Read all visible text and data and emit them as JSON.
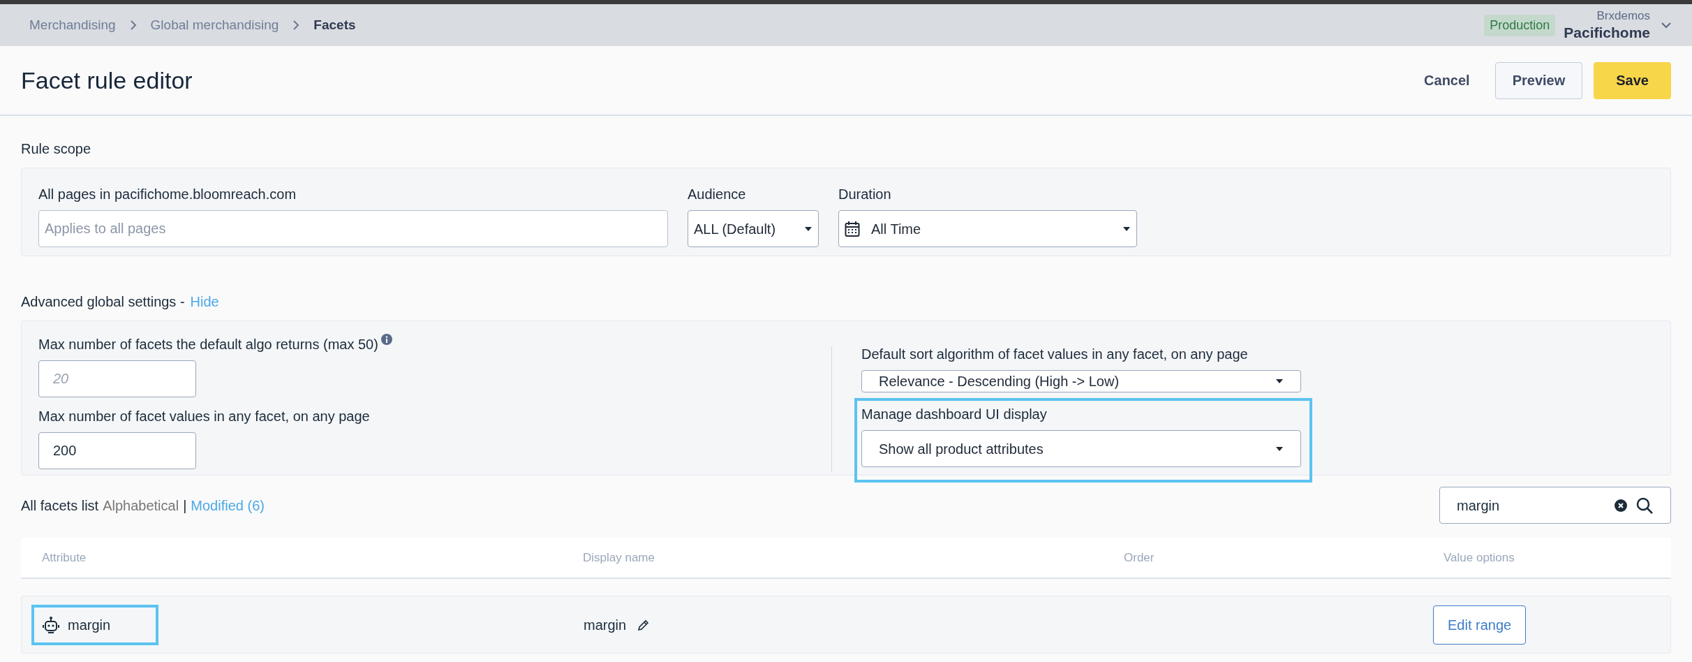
{
  "breadcrumbs": [
    {
      "label": "Merchandising",
      "current": false
    },
    {
      "label": "Global merchandising",
      "current": false
    },
    {
      "label": "Facets",
      "current": true
    }
  ],
  "account": {
    "environment": "Production",
    "org": "Brxdemos",
    "site": "Pacifichome"
  },
  "header": {
    "title": "Facet rule editor",
    "buttons": [
      {
        "label": "Cancel",
        "kind": "text"
      },
      {
        "label": "Preview",
        "kind": "outline"
      },
      {
        "label": "Save",
        "kind": "primary"
      }
    ]
  },
  "rule_scope": {
    "title": "Rule scope",
    "pages": {
      "label": "All pages in pacifichome.bloomreach.com",
      "placeholder": "Applies to all pages"
    },
    "audience": {
      "label": "Audience",
      "value": "ALL (Default)"
    },
    "duration": {
      "label": "Duration",
      "value": "All Time"
    }
  },
  "advanced": {
    "title": "Advanced global settings -",
    "toggle": "Hide",
    "max_facets": {
      "label": "Max number of facets the default algo returns (max 50)",
      "placeholder": "20"
    },
    "max_values": {
      "label": "Max number of facet values in any facet, on any page",
      "value": "200"
    },
    "sort": {
      "label": "Default sort algorithm of facet values in any facet, on any page",
      "value": "Relevance - Descending (High -> Low)"
    },
    "display": {
      "label": "Manage dashboard UI display",
      "value": "Show all product attributes"
    }
  },
  "facets": {
    "title": "All facets list",
    "sort_options": [
      {
        "label": "Alphabetical",
        "selected": true
      },
      {
        "label": "Modified (6)",
        "selected": false
      }
    ],
    "separator": "|",
    "search": {
      "value": "margin"
    },
    "table": {
      "columns": [
        "Attribute",
        "Display name",
        "Order",
        "Value options"
      ],
      "rows": [
        {
          "attribute": "margin",
          "display_name": "margin",
          "action": "Edit range"
        }
      ]
    }
  }
}
